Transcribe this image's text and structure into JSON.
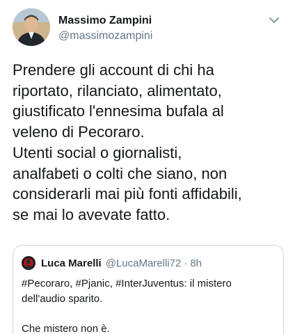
{
  "tweet": {
    "author": {
      "display_name": "Massimo Zampini",
      "handle": "@massimozampini"
    },
    "text": "Prendere gli account di chi ha\nriportato, rilanciato, alimentato,\ngiustificato l'ennesima bufala al\nveleno di Pecoraro.\nUtenti social o giornalisti,\nanalfabeti o colti che siano, non\nconsiderarli mai più fonti affidabili,\nse mai lo avevate fatto.",
    "menu_icon": "chevron-down-icon"
  },
  "quoted_tweet": {
    "author": {
      "display_name": "Luca Marelli",
      "handle": "@LucaMarelli72",
      "separator": "·",
      "time": "8h"
    },
    "text": "#Pecoraro, #Pjanic, #InterJuventus: il mistero\ndell'audio sparito.\n\nChe mistero non è."
  },
  "colors": {
    "primary_text": "#14171a",
    "secondary_text": "#657786",
    "border": "#ccd6dd"
  }
}
